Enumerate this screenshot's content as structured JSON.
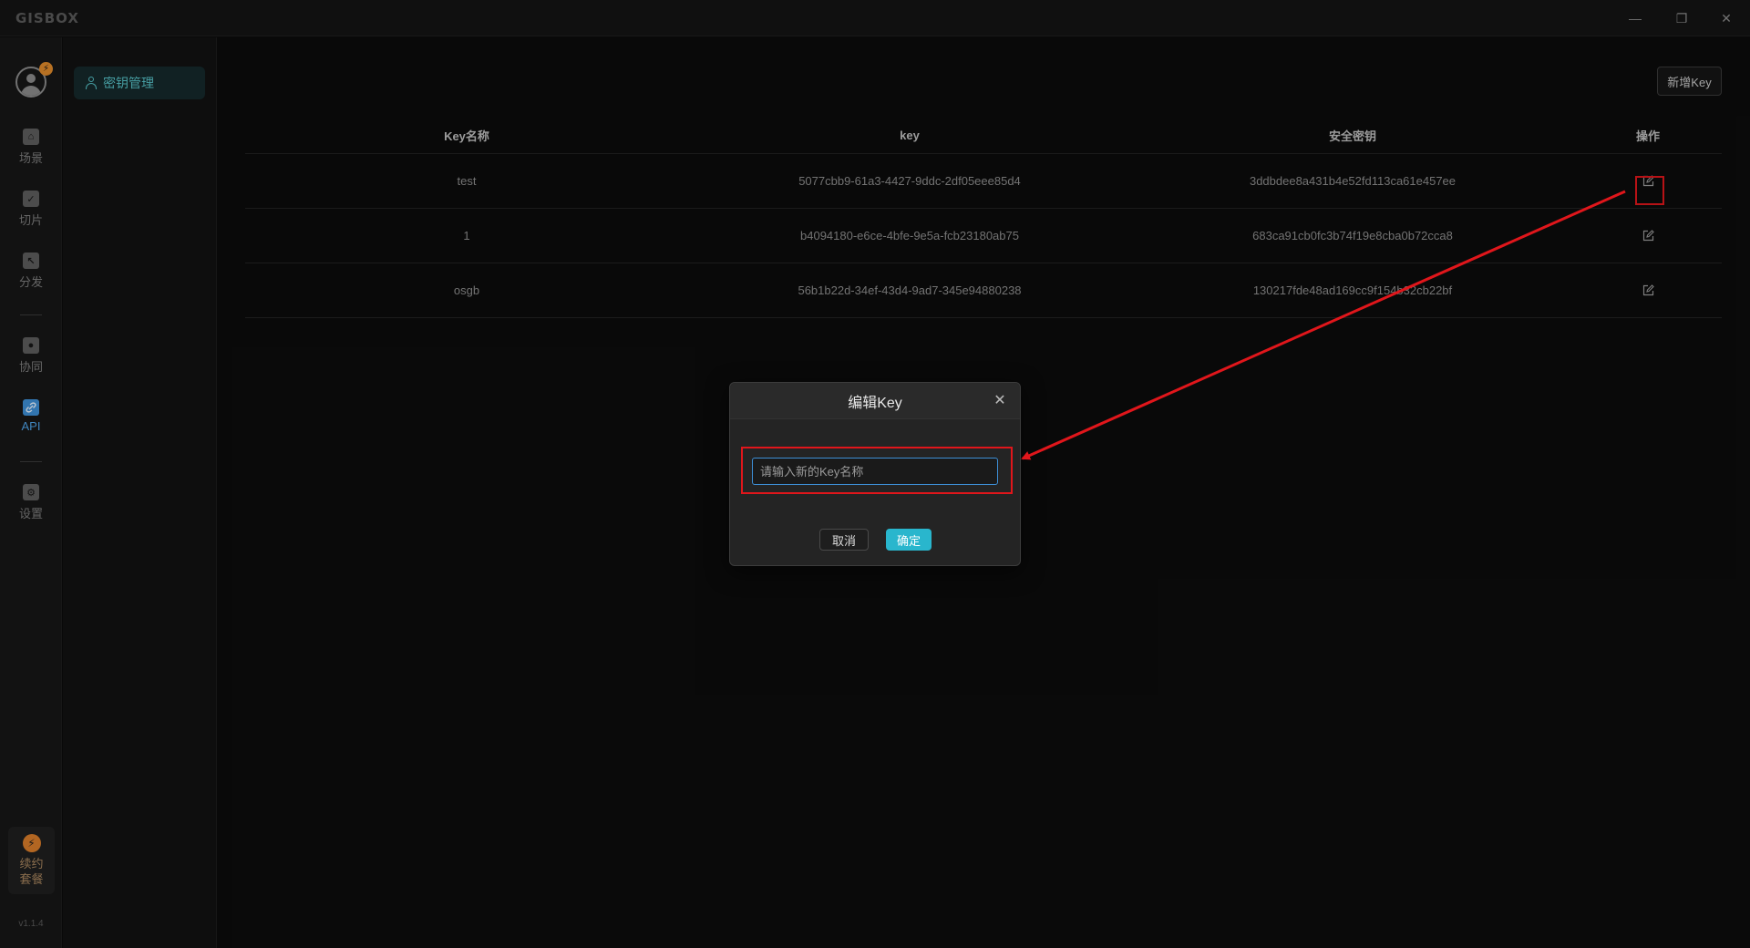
{
  "app": {
    "logo": "GISBOX",
    "window_controls": {
      "minimize": "—",
      "maximize": "❐",
      "close": "✕"
    }
  },
  "rail": {
    "avatar_badge": "⚡",
    "items": [
      {
        "label": "场景",
        "icon": "home-icon",
        "glyph": "⌂"
      },
      {
        "label": "切片",
        "icon": "check-doc-icon",
        "glyph": "✓"
      },
      {
        "label": "分发",
        "icon": "share-icon",
        "glyph": "↖"
      },
      {
        "label": "协同",
        "icon": "lock-icon",
        "glyph": "●"
      },
      {
        "label": "API",
        "icon": "link-icon",
        "glyph": "🔗"
      },
      {
        "label": "设置",
        "icon": "gear-icon",
        "glyph": "⚙"
      }
    ],
    "renew": {
      "label": "续约套餐",
      "glyph": "⚡"
    },
    "version": "v1.1.4"
  },
  "subnav": {
    "items": [
      {
        "label": "密钥管理",
        "icon": "user-icon"
      }
    ]
  },
  "main": {
    "add_button": "新增Key",
    "table": {
      "headers": [
        "Key名称",
        "key",
        "安全密钥",
        "操作"
      ],
      "rows": [
        {
          "name": "test",
          "key": "5077cbb9-61a3-4427-9ddc-2df05eee85d4",
          "secret": "3ddbdee8a431b4e52fd113ca61e457ee"
        },
        {
          "name": "1",
          "key": "b4094180-e6ce-4bfe-9e5a-fcb23180ab75",
          "secret": "683ca91cb0fc3b74f19e8cba0b72cca8"
        },
        {
          "name": "osgb",
          "key": "56b1b22d-34ef-43d4-9ad7-345e94880238",
          "secret": "130217fde48ad169cc9f154b32cb22bf"
        }
      ]
    }
  },
  "dialog": {
    "title": "编辑Key",
    "close": "✕",
    "input_placeholder": "请输入新的Key名称",
    "input_value": "",
    "cancel": "取消",
    "ok": "确定"
  },
  "annotations": {
    "highlight_color": "#e0161b"
  }
}
